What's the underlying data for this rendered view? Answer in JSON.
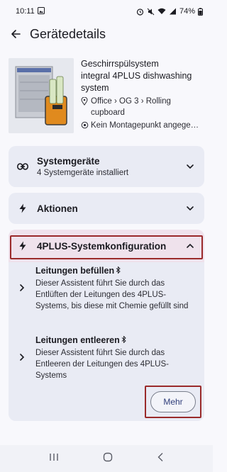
{
  "status": {
    "time": "10:11",
    "battery": "74%"
  },
  "header": {
    "title": "Gerätedetails"
  },
  "device": {
    "name": "Geschirrspülsystem",
    "model": "integral 4PLUS dishwashing system",
    "location": "Office › OG 3 › Rolling cupboard",
    "mount": "Kein Montagepunkt angege…"
  },
  "panels": {
    "systemgeraete": {
      "title": "Systemgeräte",
      "subtitle": "4 Systemgeräte installiert"
    },
    "aktionen": {
      "title": "Aktionen"
    },
    "config": {
      "title": "4PLUS-Systemkonfiguration",
      "assistants": [
        {
          "title": "Leitungen befüllen",
          "description": "Dieser Assistent führt Sie durch das Entlüften der Leitungen des 4PLUS-Systems, bis diese mit Chemie gefüllt sind"
        },
        {
          "title": "Leitungen entleeren",
          "description": "Dieser Assistent führt Sie durch das Entleeren der Leitungen des 4PLUS-Systems"
        }
      ],
      "more_label": "Mehr"
    }
  },
  "colors": {
    "accent": "#2f3e7a",
    "highlight": "#9a2a2a",
    "panel_bg": "#e9ebf4",
    "config_header_bg": "#efe2ec"
  }
}
